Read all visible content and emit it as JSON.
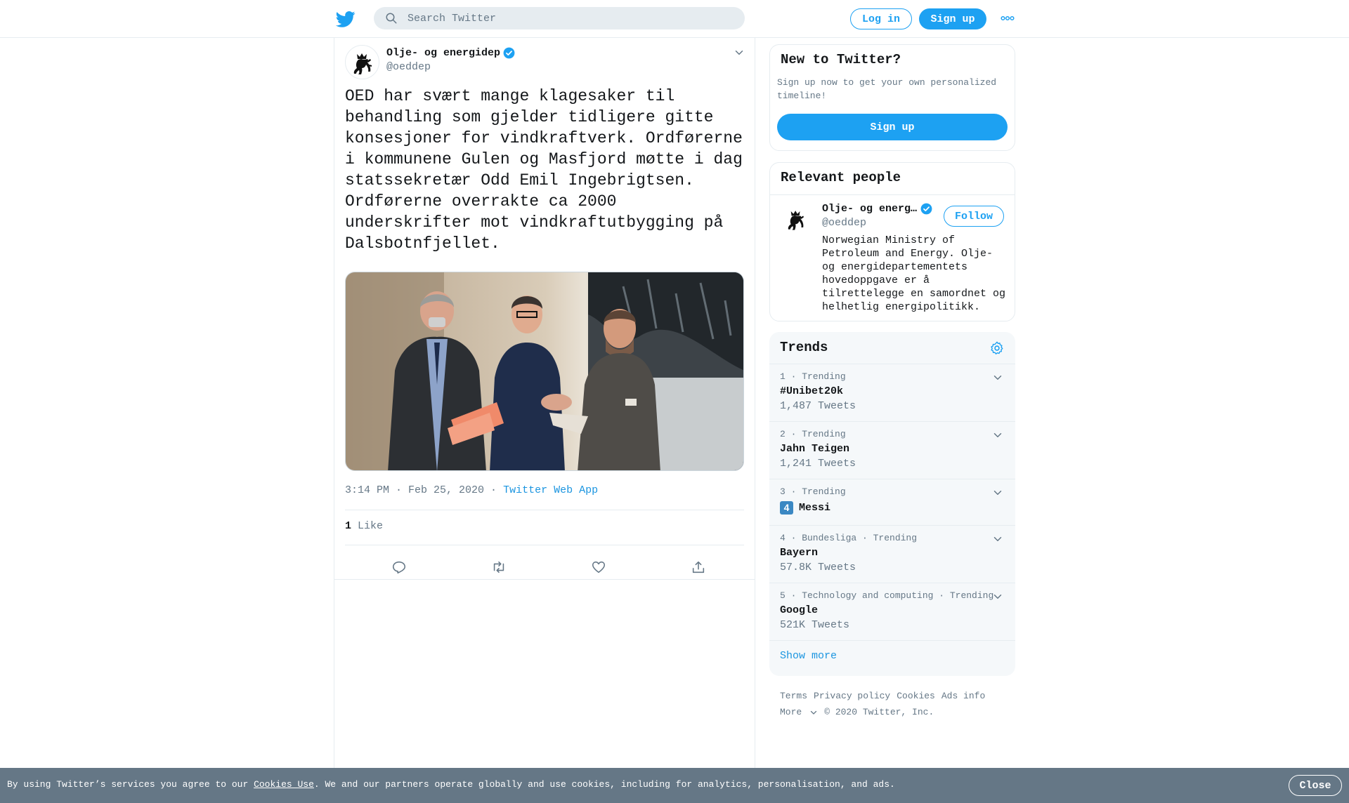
{
  "header": {
    "search_placeholder": "Search Twitter",
    "login_label": "Log in",
    "signup_label": "Sign up"
  },
  "tweet": {
    "author_name": "Olje- og energidep",
    "author_handle": "@oeddep",
    "text": "OED har svært mange klagesaker til behandling som gjelder tidligere gitte konsesjoner for vindkraftverk. Ordførerne i kommunene Gulen og Masfjord møtte i dag statssekretær Odd Emil Ingebrigtsen. Ordførerne overrakte ca 2000 underskrifter mot vindkraftutbygging på Dalsbotnfjellet.",
    "time": "3:14 PM · Feb 25, 2020",
    "separator": " · ",
    "source": "Twitter Web App",
    "like_count": "1",
    "like_label": "Like"
  },
  "new_to_twitter": {
    "title": "New to Twitter?",
    "description": "Sign up now to get your own personalized timeline!",
    "signup_label": "Sign up"
  },
  "relevant_people": {
    "title": "Relevant people",
    "name": "Olje- og energ…",
    "handle": "@oeddep",
    "follow_label": "Follow",
    "bio": "Norwegian Ministry of Petroleum and Energy. Olje- og energidepartementets hovedoppgave er å tilrettelegge en samordnet og helhetlig energipolitikk."
  },
  "trends": {
    "title": "Trends",
    "items": [
      {
        "meta": "1 · Trending",
        "name": "#Unibet20k",
        "count": "1,487 Tweets"
      },
      {
        "meta": "2 · Trending",
        "name": "Jahn Teigen",
        "count": "1,241 Tweets"
      },
      {
        "meta": "3 · Trending",
        "name": "Messi",
        "emoji": "4",
        "count": ""
      },
      {
        "meta": "4 · Bundesliga · Trending",
        "name": "Bayern",
        "count": "57.8K Tweets"
      },
      {
        "meta": "5 · Technology and computing · Trending",
        "name": "Google",
        "count": "521K Tweets"
      }
    ],
    "show_more": "Show more"
  },
  "footer": {
    "links": [
      "Terms",
      "Privacy policy",
      "Cookies",
      "Ads info"
    ],
    "more": "More",
    "copyright": "© 2020 Twitter, Inc."
  },
  "cookie": {
    "text_before": "By using Twitter’s services you agree to our ",
    "link": "Cookies Use",
    "text_after": ". We and our partners operate globally and use cookies, including for analytics, personalisation, and ads.",
    "close_label": "Close"
  },
  "colors": {
    "accent": "#1da1f2",
    "link": "#1b95e0",
    "secondary_text": "#657786",
    "cookie_bar": "#657786"
  }
}
